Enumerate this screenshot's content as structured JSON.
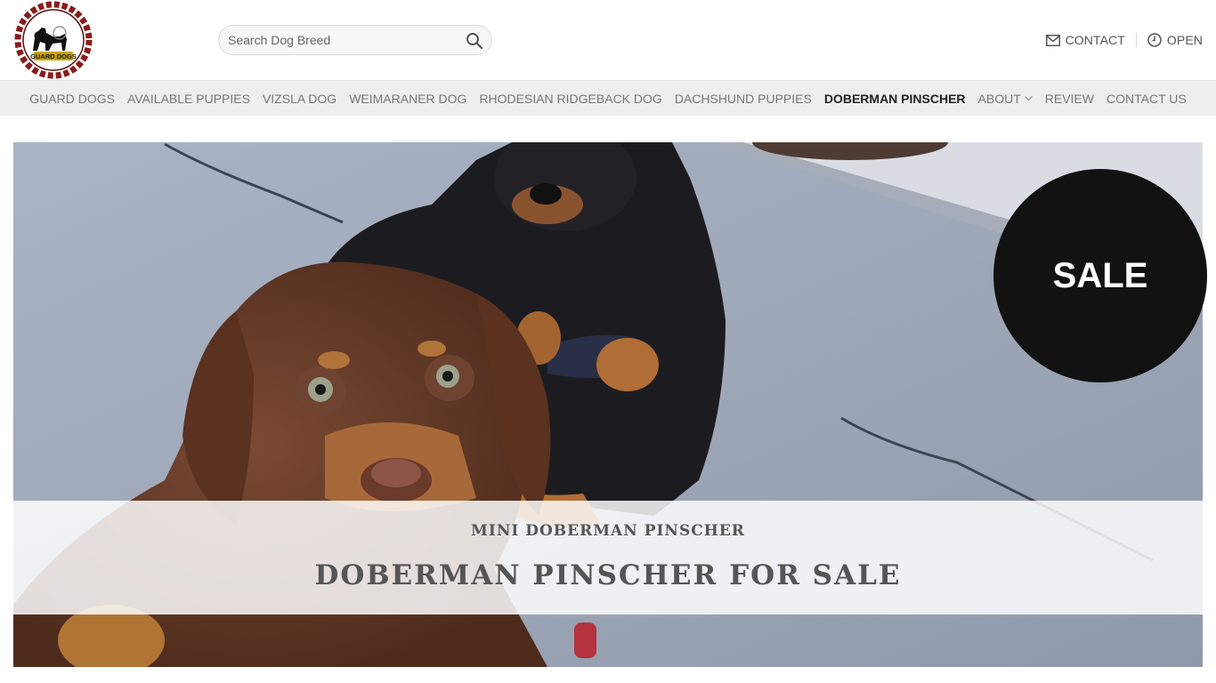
{
  "brand": {
    "logo_text": "GUARD DOGS",
    "logo_icon": "dog-chain-logo-icon",
    "colors": {
      "chain": "#8a1b1b",
      "nav_bg": "#eeeeee",
      "badge": "#121212"
    }
  },
  "search": {
    "placeholder": "Search Dog Breed",
    "value": "",
    "icon": "search-icon"
  },
  "header_links": [
    {
      "label": "CONTACT",
      "icon": "envelope-icon"
    },
    {
      "label": "OPEN",
      "icon": "clock-icon"
    }
  ],
  "nav": {
    "items": [
      {
        "label": "GUARD DOGS",
        "active": false
      },
      {
        "label": "AVAILABLE PUPPIES",
        "active": false
      },
      {
        "label": "VIZSLA DOG",
        "active": false
      },
      {
        "label": "WEIMARANER DOG",
        "active": false
      },
      {
        "label": "RHODESIAN RIDGEBACK DOG",
        "active": false
      },
      {
        "label": "DACHSHUND PUPPIES",
        "active": false
      },
      {
        "label": "DOBERMAN PINSCHER",
        "active": true
      },
      {
        "label": "ABOUT",
        "active": false,
        "dropdown": true,
        "icon": "chevron-down-icon"
      },
      {
        "label": "REVIEW",
        "active": false
      },
      {
        "label": "CONTACT US",
        "active": false
      }
    ]
  },
  "hero": {
    "image": "two-doberman-puppies-photo",
    "badge": "SALE",
    "subtitle": "MINI DOBERMAN PINSCHER",
    "title": "DOBERMAN PINSCHER FOR SALE"
  }
}
